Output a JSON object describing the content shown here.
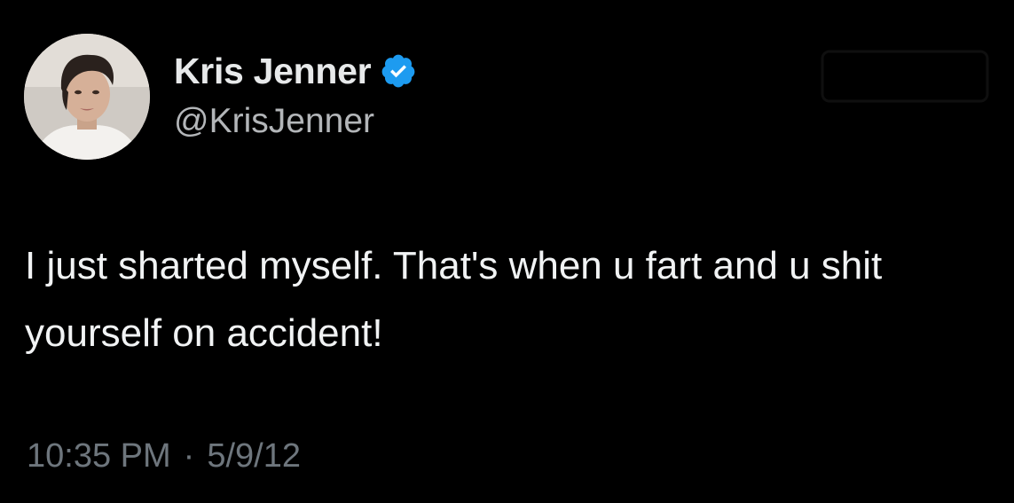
{
  "user": {
    "display_name": "Kris Jenner",
    "handle": "@KrisJenner",
    "verified": true,
    "avatar_icon": "profile-photo"
  },
  "tweet": {
    "text": "I just sharted myself. That's when u fart and u shit yourself on accident!"
  },
  "meta": {
    "time": "10:35 PM",
    "separator": "·",
    "date": "5/9/12"
  },
  "colors": {
    "background": "#000000",
    "primary_text": "#e7e9ea",
    "secondary_text": "#6e767d",
    "verified_badge": "#1d9bf0"
  }
}
